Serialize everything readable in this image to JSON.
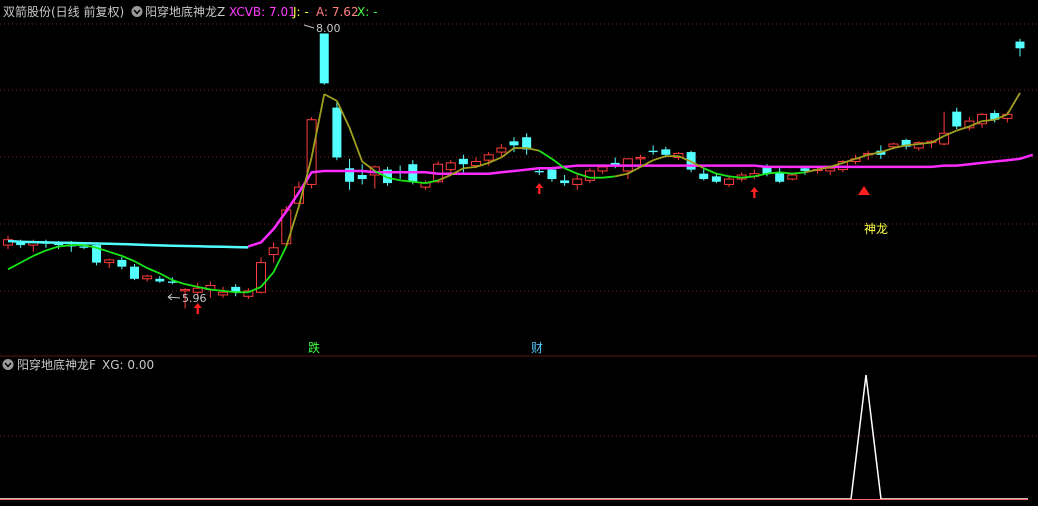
{
  "main_panel": {
    "header": {
      "stock": "双箭股份(日线 前复权)",
      "indicator_name": "阳穿地底神龙Z",
      "xcvb_label": "XCVB: 7.01",
      "j_label": "J: -",
      "a_label": "A: 7.62",
      "x_label": "X: -"
    },
    "high_marker": "8.00",
    "low_marker": "5.96",
    "signal_text": "神龙",
    "event_labels": [
      "跌",
      "财"
    ]
  },
  "sub_panel": {
    "header": {
      "indicator_name": "阳穿地底神龙F",
      "xg_label": "XG: 0.00"
    }
  },
  "colors": {
    "background": "#000000",
    "grid": "#7a1e1e",
    "candle_up": "#ff3c3c",
    "candle_down": "#54ffff",
    "ma_fast": "#19e619",
    "ma_fast_alt": "#a0a020",
    "ma_slow_cyan": "#54ffff",
    "ma_slow_magenta": "#ff2bff",
    "header_text": "#c8c8c8",
    "xcvb": "#ff3cff",
    "j": "#ffff40",
    "a": "#ff8080",
    "x": "#40ff40",
    "signal": "#ffff40",
    "arrow": "#ff2020",
    "xg_line": "#ffffff",
    "baseline": "#ff6060"
  },
  "chart_data": {
    "type": "candlestick",
    "ohlc": [
      [
        6.43,
        6.5,
        6.4,
        6.47
      ],
      [
        6.46,
        6.47,
        6.41,
        6.43
      ],
      [
        6.43,
        6.47,
        6.38,
        6.45
      ],
      [
        6.45,
        6.47,
        6.41,
        6.44
      ],
      [
        6.44,
        6.46,
        6.4,
        6.43
      ],
      [
        6.43,
        6.46,
        6.38,
        6.42
      ],
      [
        6.42,
        6.44,
        6.4,
        6.41
      ],
      [
        6.43,
        6.45,
        6.28,
        6.3
      ],
      [
        6.3,
        6.33,
        6.26,
        6.32
      ],
      [
        6.32,
        6.34,
        6.25,
        6.27
      ],
      [
        6.27,
        6.29,
        6.17,
        6.18
      ],
      [
        6.18,
        6.21,
        6.16,
        6.2
      ],
      [
        6.18,
        6.2,
        6.15,
        6.16
      ],
      [
        6.16,
        6.19,
        6.14,
        6.15
      ],
      [
        6.09,
        6.11,
        5.96,
        6.1
      ],
      [
        6.08,
        6.15,
        6.06,
        6.11
      ],
      [
        6.1,
        6.16,
        6.04,
        6.13
      ],
      [
        6.06,
        6.12,
        6.04,
        6.08
      ],
      [
        6.12,
        6.14,
        6.05,
        6.08
      ],
      [
        6.05,
        6.11,
        6.03,
        6.09
      ],
      [
        6.08,
        6.34,
        6.07,
        6.3
      ],
      [
        6.36,
        6.45,
        6.3,
        6.41
      ],
      [
        6.44,
        6.72,
        6.42,
        6.69
      ],
      [
        6.74,
        6.9,
        6.7,
        6.86
      ],
      [
        6.88,
        7.38,
        6.85,
        7.36
      ],
      [
        8.0,
        8.0,
        7.62,
        7.63
      ],
      [
        7.45,
        7.49,
        7.06,
        7.08
      ],
      [
        7.0,
        7.07,
        6.84,
        6.9
      ],
      [
        6.95,
        7.03,
        6.88,
        6.92
      ],
      [
        6.95,
        7.02,
        6.85,
        7.01
      ],
      [
        6.99,
        7.01,
        6.87,
        6.89
      ],
      [
        6.98,
        7.02,
        6.92,
        6.97
      ],
      [
        7.03,
        7.06,
        6.88,
        6.9
      ],
      [
        6.86,
        6.91,
        6.84,
        6.89
      ],
      [
        6.9,
        7.05,
        6.89,
        7.03
      ],
      [
        6.99,
        7.06,
        6.96,
        7.04
      ],
      [
        7.07,
        7.1,
        6.97,
        7.03
      ],
      [
        7.02,
        7.08,
        7.0,
        7.05
      ],
      [
        7.06,
        7.12,
        7.02,
        7.1
      ],
      [
        7.12,
        7.18,
        7.08,
        7.15
      ],
      [
        7.2,
        7.23,
        7.12,
        7.17
      ],
      [
        7.23,
        7.26,
        7.1,
        7.14
      ],
      [
        6.98,
        7.01,
        6.95,
        6.97
      ],
      [
        6.99,
        7.01,
        6.9,
        6.92
      ],
      [
        6.91,
        6.95,
        6.87,
        6.89
      ],
      [
        6.88,
        6.96,
        6.84,
        6.92
      ],
      [
        6.91,
        7.0,
        6.89,
        6.98
      ],
      [
        6.98,
        7.03,
        6.96,
        7.01
      ],
      [
        7.04,
        7.08,
        7.0,
        7.02
      ],
      [
        6.98,
        7.05,
        6.92,
        7.07
      ],
      [
        7.07,
        7.1,
        7.02,
        7.08
      ],
      [
        7.13,
        7.17,
        7.1,
        7.12
      ],
      [
        7.14,
        7.16,
        7.08,
        7.1
      ],
      [
        7.08,
        7.12,
        7.06,
        7.11
      ],
      [
        7.12,
        7.13,
        6.97,
        6.99
      ],
      [
        6.96,
        7.0,
        6.91,
        6.92
      ],
      [
        6.94,
        6.96,
        6.89,
        6.9
      ],
      [
        6.88,
        6.94,
        6.86,
        6.92
      ],
      [
        6.92,
        6.97,
        6.9,
        6.95
      ],
      [
        6.94,
        6.99,
        6.92,
        6.96
      ],
      [
        7.01,
        7.03,
        6.94,
        6.96
      ],
      [
        6.97,
        7.02,
        6.89,
        6.9
      ],
      [
        6.92,
        6.96,
        6.91,
        6.95
      ],
      [
        7.0,
        7.01,
        6.95,
        6.98
      ],
      [
        6.99,
        7.02,
        6.96,
        6.99
      ],
      [
        6.98,
        7.02,
        6.95,
        7.0
      ],
      [
        6.99,
        7.06,
        6.97,
        7.05
      ],
      [
        7.05,
        7.1,
        7.03,
        7.07
      ],
      [
        7.1,
        7.13,
        7.06,
        7.11
      ],
      [
        7.13,
        7.17,
        7.07,
        7.1
      ],
      [
        7.16,
        7.19,
        7.14,
        7.18
      ],
      [
        7.21,
        7.22,
        7.14,
        7.16
      ],
      [
        7.15,
        7.2,
        7.13,
        7.19
      ],
      [
        7.19,
        7.21,
        7.15,
        7.2
      ],
      [
        7.18,
        7.42,
        7.17,
        7.26
      ],
      [
        7.42,
        7.45,
        7.29,
        7.31
      ],
      [
        7.3,
        7.38,
        7.28,
        7.35
      ],
      [
        7.33,
        7.41,
        7.3,
        7.4
      ],
      [
        7.41,
        7.43,
        7.34,
        7.36
      ],
      [
        7.37,
        7.42,
        7.34,
        7.4
      ],
      [
        7.94,
        7.96,
        7.83,
        7.89
      ]
    ],
    "ma_fast": [
      6.25,
      6.3,
      6.35,
      6.39,
      6.42,
      6.43,
      6.43,
      6.41,
      6.38,
      6.35,
      6.31,
      6.26,
      6.22,
      6.17,
      6.14,
      6.12,
      6.1,
      6.09,
      6.08,
      6.08,
      6.12,
      6.23,
      6.42,
      6.72,
      7.08,
      7.55,
      7.5,
      7.3,
      7.05,
      6.98,
      6.93,
      6.91,
      6.9,
      6.89,
      6.91,
      6.95,
      7.0,
      7.01,
      7.04,
      7.08,
      7.15,
      7.15,
      7.13,
      7.07,
      7.0,
      6.96,
      6.93,
      6.93,
      6.94,
      6.96,
      7.01,
      7.06,
      7.09,
      7.09,
      7.05,
      7.0,
      6.96,
      6.94,
      6.93,
      6.94,
      6.96,
      6.97,
      6.96,
      6.97,
      6.99,
      7.01,
      7.04,
      7.07,
      7.1,
      7.12,
      7.15,
      7.17,
      7.18,
      7.19,
      7.24,
      7.28,
      7.31,
      7.35,
      7.36,
      7.4,
      7.56
    ],
    "ma_slow_cyan": [
      6.46,
      6.455,
      6.452,
      6.45,
      6.448,
      6.446,
      6.444,
      6.442,
      6.44,
      6.437,
      6.434,
      6.431,
      6.428,
      6.425,
      6.423,
      6.421,
      6.419,
      6.417,
      6.415,
      6.413
    ],
    "ma_slow_magenta": [
      6.42,
      6.45,
      6.55,
      6.68,
      6.82,
      6.97,
      6.98,
      6.98,
      6.98,
      6.98,
      6.97,
      6.97,
      6.97,
      6.97,
      6.97,
      6.96,
      6.96,
      6.96,
      6.96,
      6.96,
      6.97,
      6.98,
      6.99,
      7.0,
      7.0,
      7.01,
      7.02,
      7.02,
      7.02,
      7.02,
      7.02,
      7.02,
      7.02,
      7.02,
      7.02,
      7.02,
      7.02,
      7.02,
      7.02,
      7.02,
      7.02,
      7.01,
      7.01,
      7.01,
      7.01,
      7.01,
      7.01,
      7.01,
      7.01,
      7.01,
      7.01,
      7.01,
      7.01,
      7.01,
      7.01,
      7.02,
      7.02,
      7.03,
      7.04,
      7.05,
      7.06,
      7.07,
      7.1
    ],
    "ylim": [
      5.8,
      8.1
    ],
    "up_arrows_at": [
      15,
      42,
      59
    ],
    "signal_at": 86,
    "xg": {
      "peak_at": 86,
      "value": 1,
      "ylim": [
        0,
        1
      ]
    }
  }
}
